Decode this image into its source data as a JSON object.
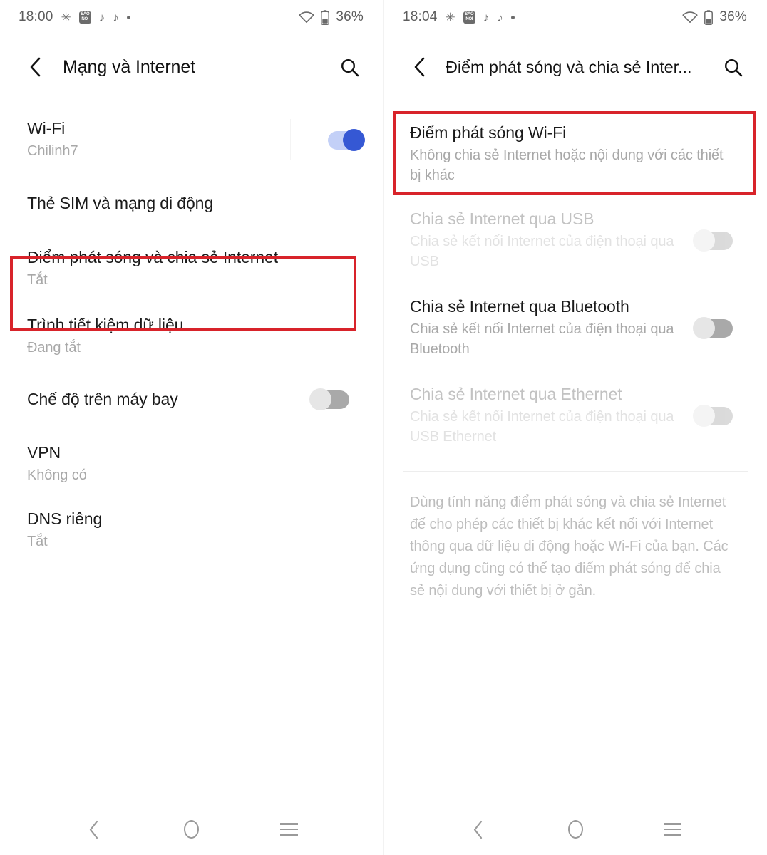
{
  "colors": {
    "accent_toggle_on": "#3558d4",
    "accent_toggle_on_track": "#c3d0f7",
    "highlight_box": "#d8232a",
    "title_text": "#1a1a1a",
    "subtitle_text": "#a8a8a8",
    "disabled_text": "#c2c2c2"
  },
  "left_screen": {
    "status_bar": {
      "time": "18:00",
      "battery_percent": "36%",
      "icons": [
        "gear-icon",
        "mono-badge-icon",
        "tiktok-icon",
        "tiktok-icon",
        "dot-icon",
        "wifi-icon",
        "battery-icon"
      ]
    },
    "app_bar": {
      "back_icon": "chevron-left-icon",
      "title": "Mạng và Internet",
      "search_icon": "search-icon"
    },
    "items": [
      {
        "title": "Wi-Fi",
        "subtitle": "Chilinh7",
        "toggle": "on",
        "divider_before_toggle": true,
        "disabled": false,
        "highlighted": false
      },
      {
        "title": "Thẻ SIM và mạng di động",
        "subtitle": "",
        "toggle": "none",
        "disabled": false,
        "highlighted": false
      },
      {
        "title": "Điểm phát sóng và chia sẻ Internet",
        "subtitle": "Tắt",
        "toggle": "none",
        "disabled": false,
        "highlighted": true
      },
      {
        "title": "Trình tiết kiệm dữ liệu",
        "subtitle": "Đang tắt",
        "toggle": "none",
        "disabled": false,
        "highlighted": false
      },
      {
        "title": "Chế độ trên máy bay",
        "subtitle": "",
        "toggle": "off",
        "disabled": false,
        "highlighted": false
      },
      {
        "title": "VPN",
        "subtitle": "Không có",
        "toggle": "none",
        "disabled": false,
        "highlighted": false
      },
      {
        "title": "DNS riêng",
        "subtitle": "Tắt",
        "toggle": "none",
        "disabled": false,
        "highlighted": false
      }
    ],
    "nav_bar": {
      "back": "chevron-left-icon",
      "home": "circle-icon",
      "recents": "hamburger-icon"
    }
  },
  "right_screen": {
    "status_bar": {
      "time": "18:04",
      "battery_percent": "36%",
      "icons": [
        "gear-icon",
        "mono-badge-icon",
        "tiktok-icon",
        "tiktok-icon",
        "dot-icon",
        "wifi-icon",
        "battery-icon"
      ]
    },
    "app_bar": {
      "back_icon": "chevron-left-icon",
      "title": "Điểm phát sóng và chia sẻ Inter...",
      "search_icon": "search-icon"
    },
    "items": [
      {
        "title": "Điểm phát sóng Wi-Fi",
        "subtitle": "Không chia sẻ Internet hoặc nội dung với các thiết bị khác",
        "toggle": "none",
        "disabled": false,
        "highlighted": true
      },
      {
        "title": "Chia sẻ Internet qua USB",
        "subtitle": "Chia sẻ kết nối Internet của điện thoại qua USB",
        "toggle": "off",
        "disabled": true,
        "highlighted": false
      },
      {
        "title": "Chia sẻ Internet qua Bluetooth",
        "subtitle": "Chia sẻ kết nối Internet của điện thoại qua Bluetooth",
        "toggle": "off",
        "disabled": false,
        "highlighted": false
      },
      {
        "title": "Chia sẻ Internet qua Ethernet",
        "subtitle": "Chia sẻ kết nối Internet của điện thoại qua USB Ethernet",
        "toggle": "off",
        "disabled": true,
        "highlighted": false
      }
    ],
    "footer_note": "Dùng tính năng điểm phát sóng và chia sẻ Internet để cho phép các thiết bị khác kết nối với Internet thông qua dữ liệu di động hoặc Wi-Fi của bạn. Các ứng dụng cũng có thể tạo điểm phát sóng để chia sẻ nội dung với thiết bị ở gần.",
    "nav_bar": {
      "back": "chevron-left-icon",
      "home": "circle-icon",
      "recents": "hamburger-icon"
    }
  }
}
